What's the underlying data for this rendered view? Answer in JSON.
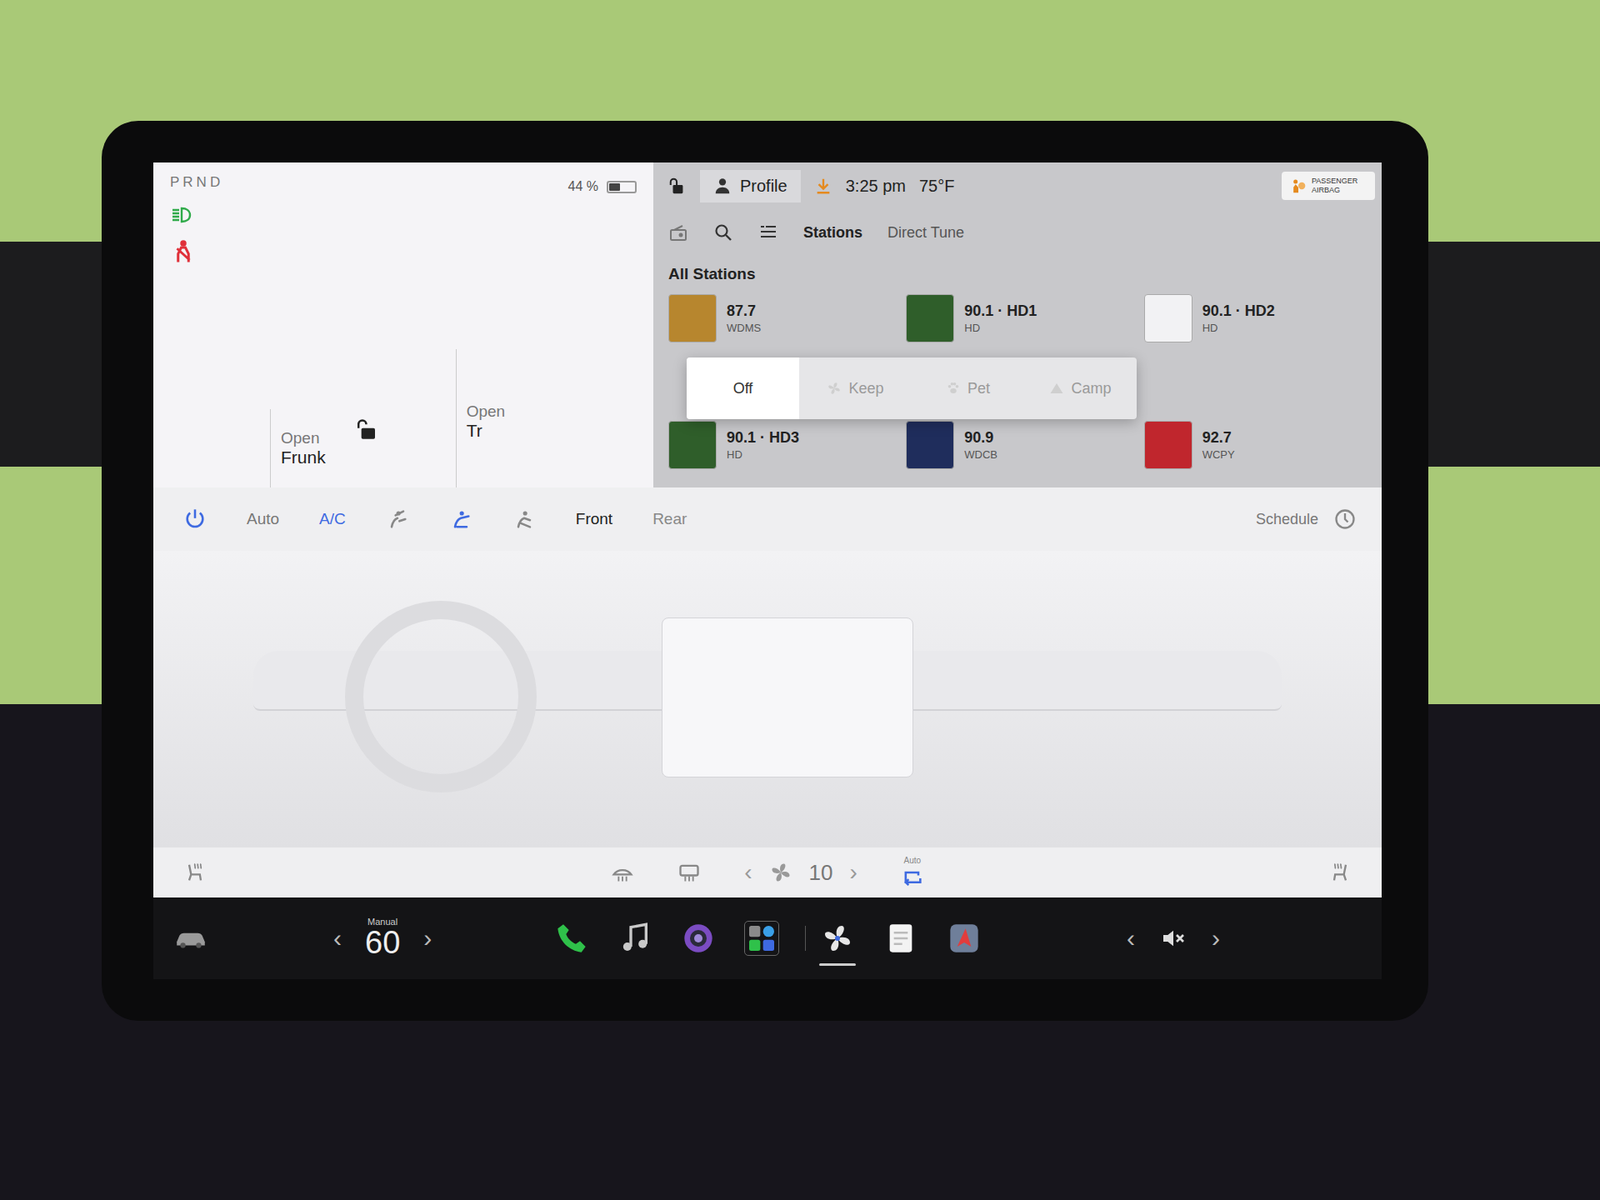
{
  "car_panel": {
    "gear": "PRND",
    "battery": {
      "reading": "44 %",
      "level": 0.44
    },
    "locked": false,
    "frunk": {
      "label": "Open",
      "sub": "Frunk"
    },
    "trunk": {
      "label": "Open",
      "sub": "Tr"
    },
    "seatbelt_warning": true
  },
  "status_bar": {
    "profile": "Profile",
    "time": "3:25 pm",
    "temperature": "75°F",
    "airbag": "PASSENGER AIRBAG",
    "locked": false
  },
  "media": {
    "tabs": [
      {
        "label": "Stations",
        "selected": true
      },
      {
        "label": "Direct Tune",
        "selected": false
      }
    ],
    "heading": "All Stations",
    "stations": [
      {
        "frequency": "87.7",
        "sub": "WDMS",
        "color": "#b7862e"
      },
      {
        "frequency": "90.1 · HD1",
        "sub": "HD",
        "color": "#2f5e2a"
      },
      {
        "frequency": "90.1 · HD2",
        "sub": "HD",
        "color": "#f2f2f4"
      },
      {
        "frequency": "90.1 · HD3",
        "sub": "HD",
        "color": "#2f5e2a"
      },
      {
        "frequency": "90.9",
        "sub": "WDCB",
        "color": "#1f2d5c"
      },
      {
        "frequency": "92.7",
        "sub": "WCPY",
        "color": "#c0262d"
      }
    ]
  },
  "keep_menu": {
    "options": [
      {
        "label": "Off",
        "selected": true
      },
      {
        "label": "Keep",
        "selected": false
      },
      {
        "label": "Pet",
        "selected": false
      },
      {
        "label": "Camp",
        "selected": false
      }
    ]
  },
  "climate": {
    "power": true,
    "auto": {
      "label": "Auto",
      "on": false
    },
    "ac": {
      "label": "A/C",
      "on": true
    },
    "airflow": [
      {
        "selected": false
      },
      {
        "selected": true
      },
      {
        "selected": false
      }
    ],
    "zones": [
      {
        "label": "Front",
        "selected": true
      },
      {
        "label": "Rear",
        "selected": false
      }
    ],
    "schedule": "Schedule",
    "fan": "10",
    "recirc": {
      "label": "Auto",
      "on": true
    }
  },
  "chevrons": {
    "prev": "‹",
    "next": "›"
  },
  "dock": {
    "temperature": {
      "label": "Manual",
      "value": "60"
    },
    "apps": [
      {
        "kind": "phone",
        "selected": false
      },
      {
        "kind": "music",
        "selected": false
      },
      {
        "kind": "camera",
        "selected": false
      },
      {
        "kind": "apps",
        "selected": false
      },
      {
        "kind": "climate",
        "selected": true
      },
      {
        "kind": "notes",
        "selected": false
      },
      {
        "kind": "navigation",
        "selected": false
      }
    ],
    "muted": true
  }
}
